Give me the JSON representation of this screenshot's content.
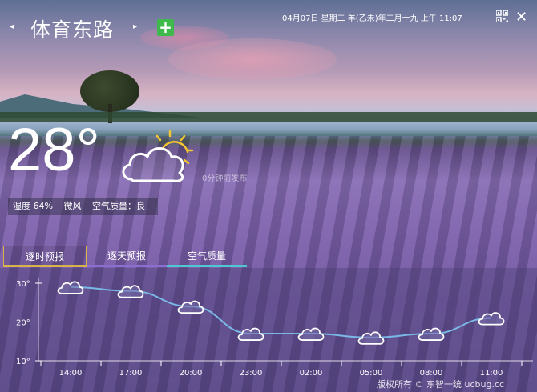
{
  "header": {
    "city": "体育东路",
    "prev_icon": "◂",
    "next_icon": "▸",
    "add_label": "+",
    "date": "04月07日 星期二  羊(乙未)年二月十九  上午 11:07",
    "close_label": "✕"
  },
  "current": {
    "temperature": "28°",
    "updated": "0分钟前发布",
    "humidity": "湿度 64%",
    "wind": "微风",
    "air_quality": "空气质量：良"
  },
  "tabs": [
    {
      "label": "逐时预报"
    },
    {
      "label": "逐天预报"
    },
    {
      "label": "空气质量"
    }
  ],
  "colors": {
    "add": "#3dba4b",
    "tab1": "#d8b24a",
    "tab2": "#8a6fd0",
    "tab3": "#4fc6d0",
    "line": "#7ab8e6"
  },
  "chart_data": {
    "type": "line",
    "x": [
      "14:00",
      "17:00",
      "20:00",
      "23:00",
      "02:00",
      "05:00",
      "08:00",
      "11:00"
    ],
    "y_ticks": [
      "30°",
      "20°",
      "10°"
    ],
    "ylim": [
      10,
      30
    ],
    "series": [
      {
        "values": [
          29,
          28,
          24,
          17,
          17,
          16,
          17,
          21
        ],
        "icon": "cloud-icon"
      }
    ]
  },
  "footer": {
    "copyright": "版权所有 © 东智一统 ucbug.cc"
  }
}
